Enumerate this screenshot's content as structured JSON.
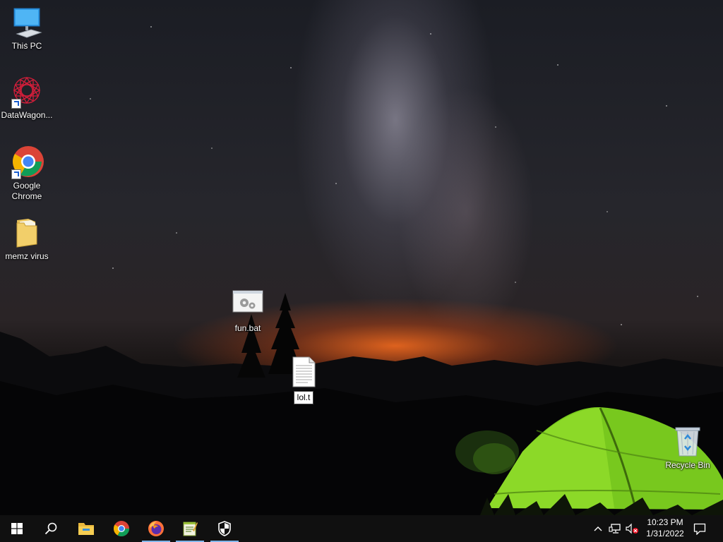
{
  "desktop": {
    "icons": [
      {
        "label": "This PC",
        "icon": "monitor-icon"
      },
      {
        "label": "DataWagon...",
        "icon": "geometric-mandala-icon"
      },
      {
        "label": "Google Chrome",
        "icon": "chrome-icon"
      },
      {
        "label": "memz virus",
        "icon": "folder-icon"
      },
      {
        "label": "fun.bat",
        "icon": "batch-file-icon"
      },
      {
        "label": "Recycle Bin",
        "icon": "recycle-bin-icon"
      }
    ],
    "rename_file": {
      "value": "lol.t",
      "icon": "text-file-icon"
    }
  },
  "taskbar": {
    "apps": [
      {
        "name": "Start",
        "icon": "windows-logo-icon"
      },
      {
        "name": "Search",
        "icon": "search-icon"
      },
      {
        "name": "File Explorer",
        "icon": "folder-icon"
      },
      {
        "name": "Google Chrome",
        "icon": "chrome-icon"
      },
      {
        "name": "Firefox",
        "icon": "firefox-icon"
      },
      {
        "name": "Notepad",
        "icon": "notepad-icon"
      },
      {
        "name": "Windows Security",
        "icon": "shield-icon"
      }
    ],
    "tray": {
      "time": "10:23 PM",
      "date": "1/31/2022"
    }
  },
  "colors": {
    "taskbar_bg": "#101010",
    "active_indicator": "#7fb5ea",
    "tent_green": "#7dd11e",
    "sunset_orange": "#ff6e1e"
  }
}
